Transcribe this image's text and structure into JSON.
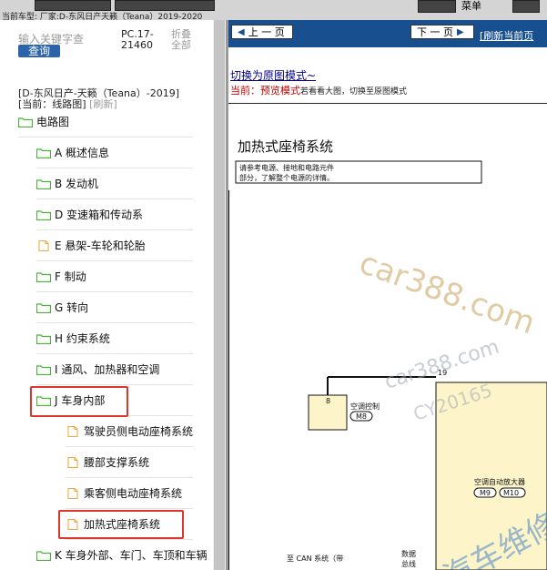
{
  "topbar": {
    "current_car": "当前车型:   厂家:D-东风日产天籁（Teana）2019-2020",
    "menu": "菜单"
  },
  "sidebar": {
    "search_placeholder": "输入关键字查",
    "query_button": "查询",
    "pc_code": "PC.17-21460",
    "collapse_all": "折叠全部",
    "title": "[D-东风日产-天籁（Teana）-2019]",
    "current_label": "[当前：线路图]",
    "refresh_label": "[刷新]",
    "items": [
      {
        "label": "电路图",
        "icon": "folder-open-icon"
      },
      {
        "label": "A 概述信息",
        "icon": "folder-icon"
      },
      {
        "label": "B 发动机",
        "icon": "folder-icon"
      },
      {
        "label": "D 变速箱和传动系",
        "icon": "folder-icon"
      },
      {
        "label": "E 悬架-车轮和轮胎",
        "icon": "file-icon"
      },
      {
        "label": "F 制动",
        "icon": "folder-icon"
      },
      {
        "label": "G 转向",
        "icon": "folder-icon"
      },
      {
        "label": "H 约束系统",
        "icon": "folder-icon"
      },
      {
        "label": "I 通风、加热器和空调",
        "icon": "folder-icon"
      },
      {
        "label": "J 车身内部",
        "icon": "folder-open-icon"
      },
      {
        "label": "驾驶员侧电动座椅系统",
        "icon": "file-icon"
      },
      {
        "label": "腰部支撑系统",
        "icon": "file-icon"
      },
      {
        "label": "乘客侧电动座椅系统",
        "icon": "file-icon"
      },
      {
        "label": "加热式座椅系统",
        "icon": "file-icon"
      },
      {
        "label": "K 车身外部、车门、车顶和车辆",
        "icon": "folder-icon"
      }
    ]
  },
  "content": {
    "prev_page": "上 一 页",
    "next_page": "下 一 页",
    "refresh_current": "[刷新当前页",
    "switch_mode": "切换为原图模式~",
    "status_prefix": "当前：",
    "status_mode": "预览模式",
    "status_tip": "若看看大图，切换至原图模式",
    "diagram": {
      "title": "加热式座椅系统",
      "note_line1": "请参考电源、接地和电路元件",
      "note_line2": "部分，了解整个电源的详情。",
      "pin_8": "8",
      "pin_19": "19",
      "ac_control": "空调控制",
      "connector_m8": "M8",
      "ac_amp": "空调自动放大器",
      "connector_m9": "M9",
      "connector_m10": "M10",
      "can_system": "至 CAN 系统（带",
      "data_label": "数据",
      "bus_label": "总线",
      "watermark_1": "car388.com",
      "watermark_2": "car388.com",
      "watermark_3": "CY20165",
      "watermark_4": "汽车维修"
    }
  },
  "colors": {
    "nav_blue": "#18508f",
    "highlight_red": "#e0352b",
    "folder_green": "#4cae3b",
    "file_orange": "#f0a43a"
  }
}
